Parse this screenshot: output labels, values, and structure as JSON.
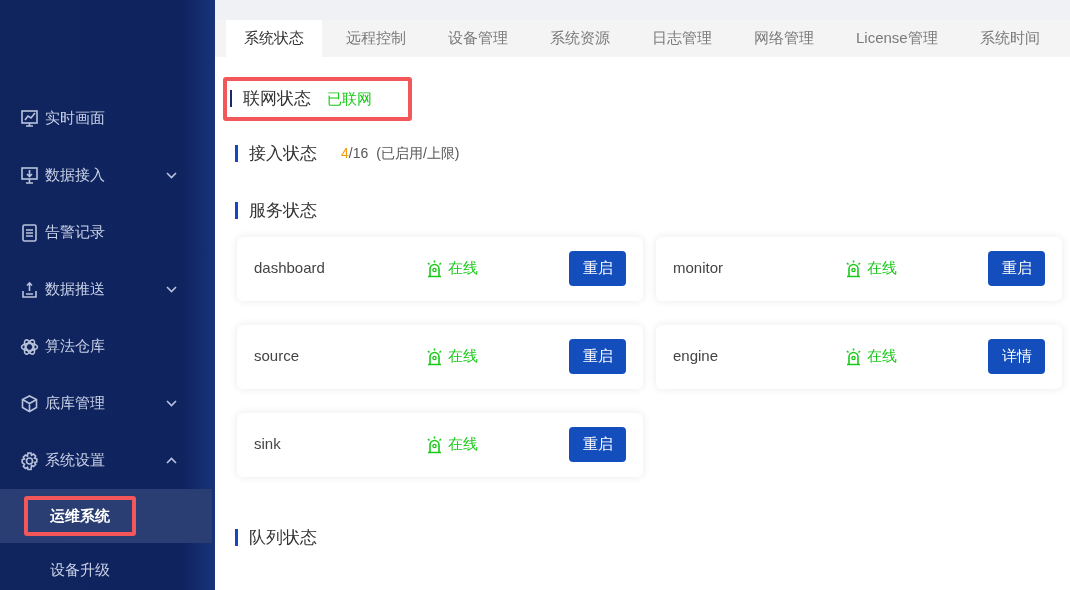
{
  "sidebar": {
    "items": [
      {
        "label": "实时画面"
      },
      {
        "label": "数据接入",
        "expanded": false
      },
      {
        "label": "告警记录"
      },
      {
        "label": "数据推送",
        "expanded": false
      },
      {
        "label": "算法仓库"
      },
      {
        "label": "底库管理",
        "expanded": false
      },
      {
        "label": "系统设置",
        "expanded": true,
        "children": [
          {
            "label": "运维系统",
            "selected": true,
            "highlighted": true
          },
          {
            "label": "设备升级",
            "selected": false,
            "highlighted": false
          }
        ]
      }
    ]
  },
  "tabs": [
    {
      "label": "系统状态",
      "selected": true
    },
    {
      "label": "远程控制",
      "selected": false
    },
    {
      "label": "设备管理",
      "selected": false
    },
    {
      "label": "系统资源",
      "selected": false
    },
    {
      "label": "日志管理",
      "selected": false
    },
    {
      "label": "网络管理",
      "selected": false
    },
    {
      "label": "License管理",
      "selected": false
    },
    {
      "label": "系统时间",
      "selected": false
    }
  ],
  "network": {
    "title": "联网状态",
    "value": "已联网",
    "highlighted": true
  },
  "access": {
    "title": "接入状态",
    "used": "4",
    "limit": "/16",
    "note": "(已启用/上限)"
  },
  "services": {
    "title": "服务状态",
    "items": [
      {
        "name": "dashboard",
        "status": "在线",
        "button": "重启"
      },
      {
        "name": "monitor",
        "status": "在线",
        "button": "重启"
      },
      {
        "name": "source",
        "status": "在线",
        "button": "重启"
      },
      {
        "name": "engine",
        "status": "在线",
        "button": "详情"
      },
      {
        "name": "sink",
        "status": "在线",
        "button": "重启"
      }
    ]
  },
  "queue": {
    "title": "队列状态"
  }
}
